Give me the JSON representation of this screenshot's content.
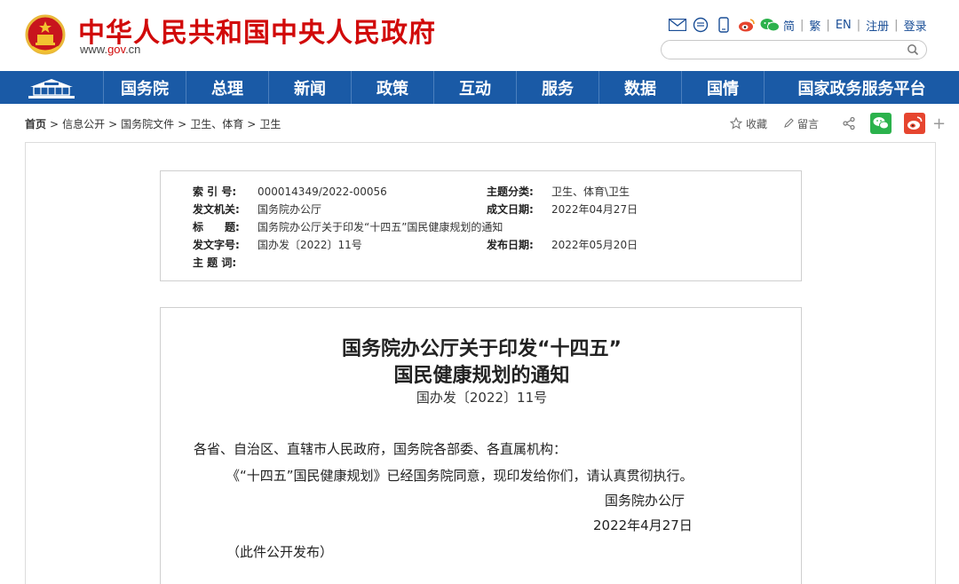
{
  "header": {
    "site_title": "中华人民共和国中央人民政府",
    "site_url_prefix": "www.",
    "site_url_brand": "gov",
    "site_url_suffix": ".cn",
    "emblem_icon": "national-emblem-icon"
  },
  "top_links": {
    "icons": [
      "mail-icon",
      "message-icon",
      "mobile-icon",
      "weibo-icon",
      "wechat-icon"
    ],
    "simplified": "简",
    "traditional": "繁",
    "english": "EN",
    "register": "注册",
    "login": "登录"
  },
  "search": {
    "placeholder": ""
  },
  "nav": {
    "items": [
      "国务院",
      "总理",
      "新闻",
      "政策",
      "互动",
      "服务",
      "数据",
      "国情",
      "国家政务服务平台"
    ]
  },
  "breadcrumb": [
    "首页",
    "信息公开",
    "国务院文件",
    "卫生、体育",
    "卫生"
  ],
  "actions": {
    "favorite": "收藏",
    "message": "留言"
  },
  "meta": {
    "index_label": "索 引 号:",
    "index_value": "000014349/2022-00056",
    "topic_label": "主题分类:",
    "topic_value": "卫生、体育\\卫生",
    "issuer_label": "发文机关:",
    "issuer_value": "国务院办公厅",
    "created_label": "成文日期:",
    "created_value": "2022年04月27日",
    "title_label": "标　　题:",
    "title_value": "国务院办公厅关于印发“十四五”国民健康规划的通知",
    "docno_label": "发文字号:",
    "docno_value": "国办发〔2022〕11号",
    "published_label": "发布日期:",
    "published_value": "2022年05月20日",
    "keywords_label": "主 题 词:",
    "keywords_value": ""
  },
  "document": {
    "title_line1": "国务院办公厅关于印发“十四五”",
    "title_line2": "国民健康规划的通知",
    "doc_number": "国办发〔2022〕11号",
    "salutation": "各省、自治区、直辖市人民政府，国务院各部委、各直属机构：",
    "body": "《“十四五”国民健康规划》已经国务院同意，现印发给你们，请认真贯彻执行。",
    "signature": "国务院办公厅",
    "date": "2022年4月27日",
    "note": "（此件公开发布）"
  },
  "colors": {
    "brand_red": "#d10a0a",
    "nav_blue": "#1a5aa6",
    "link_blue": "#1a4e96",
    "wechat_green": "#2bb24c",
    "weibo_red": "#e6452f"
  }
}
